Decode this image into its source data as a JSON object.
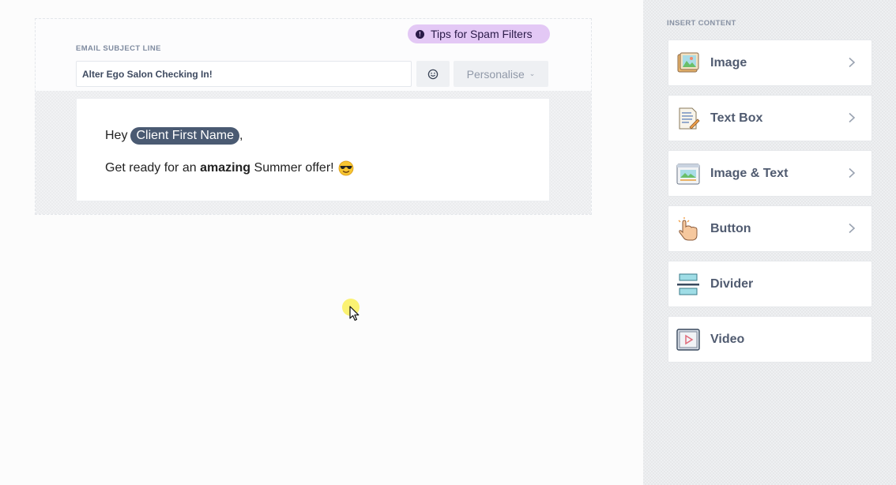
{
  "editor": {
    "spam_tips_label": "Tips for Spam Filters",
    "subject_label": "EMAIL SUBJECT LINE",
    "subject_value": "Alter Ego Salon Checking In!",
    "emoji_icon": "smiley-icon",
    "personalise_label": "Personalise",
    "email": {
      "greeting": "Hey",
      "merge_tag": "Client First Name",
      "greeting_suffix": ",",
      "body_before": "Get ready for an ",
      "body_bold": "amazing",
      "body_after": " Summer offer!",
      "emoji": "sunglasses-emoji"
    }
  },
  "sidebar": {
    "title": "INSERT CONTENT",
    "items": [
      {
        "label": "Image",
        "icon": "image-icon",
        "has_chevron": true
      },
      {
        "label": "Text Box",
        "icon": "text-box-icon",
        "has_chevron": true
      },
      {
        "label": "Image & Text",
        "icon": "image-text-icon",
        "has_chevron": true
      },
      {
        "label": "Button",
        "icon": "button-hand-icon",
        "has_chevron": true
      },
      {
        "label": "Divider",
        "icon": "divider-icon",
        "has_chevron": false
      },
      {
        "label": "Video",
        "icon": "video-icon",
        "has_chevron": false
      }
    ]
  },
  "colors": {
    "spam_tips_bg": "#e3c8f5",
    "merge_tag_bg": "#4a5a72",
    "cursor_highlight": "#faf05a"
  }
}
